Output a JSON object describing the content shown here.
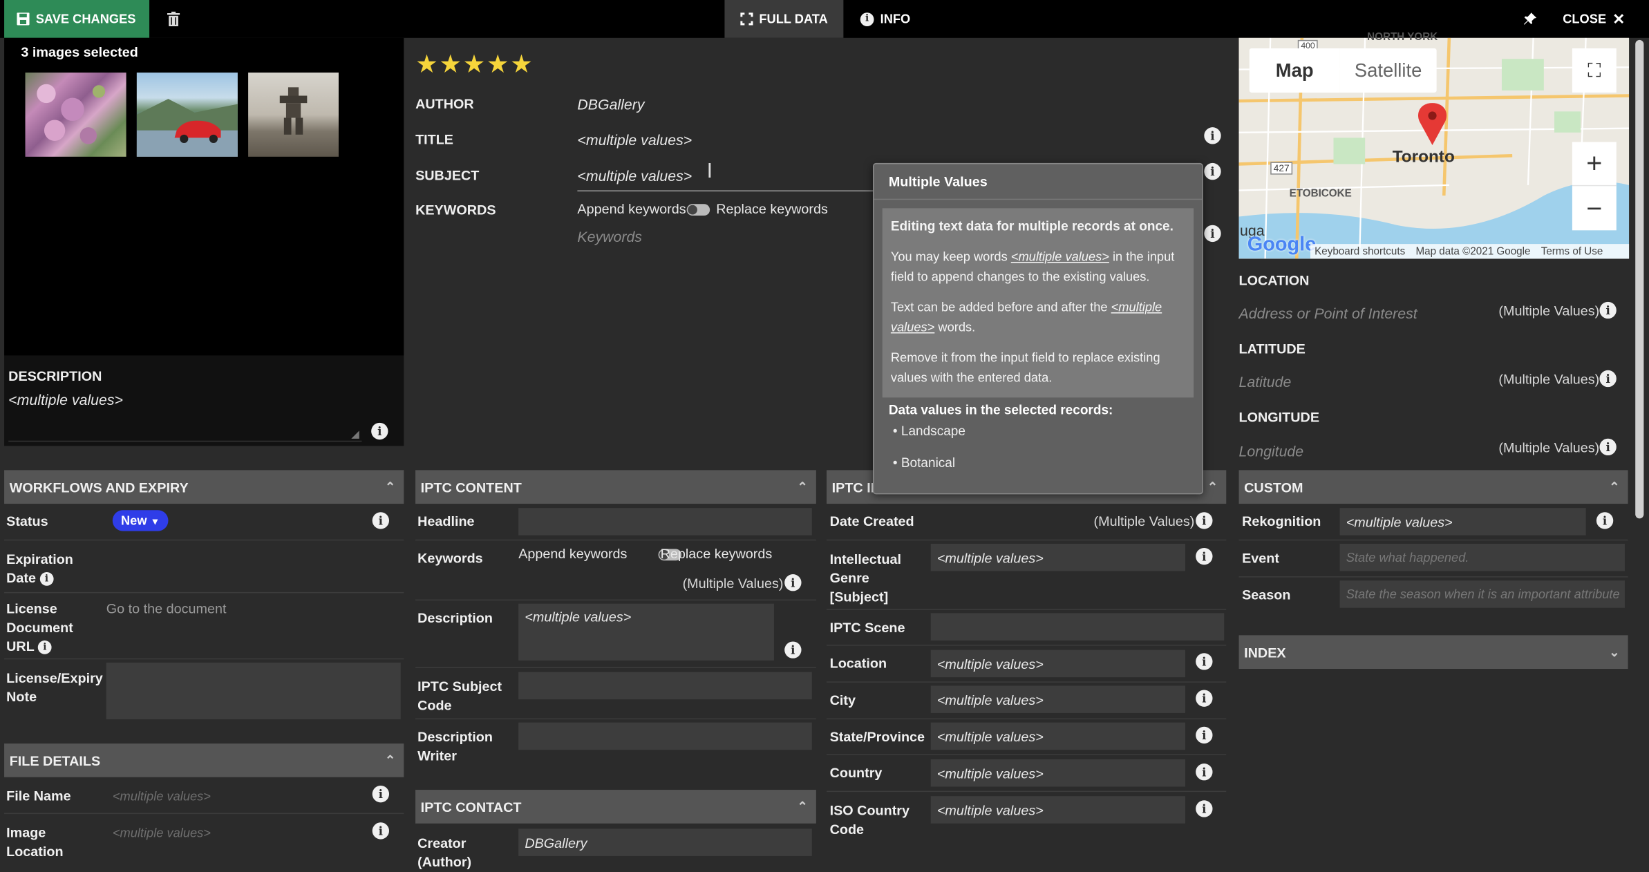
{
  "toolbar": {
    "save": "SAVE CHANGES",
    "full_data": "FULL DATA",
    "info": "INFO",
    "close": "CLOSE"
  },
  "selection": {
    "count_label": "3 images selected"
  },
  "rating": {
    "stars": 5
  },
  "description": {
    "label": "DESCRIPTION",
    "value": "<multiple values>"
  },
  "fields": {
    "author": {
      "label": "AUTHOR",
      "value": "DBGallery"
    },
    "title": {
      "label": "TITLE",
      "value": "<multiple values>"
    },
    "subject": {
      "label": "SUBJECT",
      "value": "<multiple values>"
    },
    "keywords": {
      "label": "KEYWORDS",
      "append": "Append keywords",
      "replace": "Replace keywords",
      "placeholder": "Keywords"
    }
  },
  "tooltip": {
    "title": "Multiple Values",
    "heading": "Editing text data for multiple records at once.",
    "p1a": "You may keep words ",
    "p1link": "<multiple values>",
    "p1b": " in the input field to append changes to the existing values.",
    "p2a": "Text can be added before and after the ",
    "p2link": "<multiple values>",
    "p2b": " words.",
    "p3": "Remove it from the input field to replace existing values with the entered data.",
    "values_heading": "Data values in the selected records:",
    "values": [
      "Landscape",
      "Botanical"
    ]
  },
  "map": {
    "map_tab": "Map",
    "satellite_tab": "Satellite",
    "city": "Toronto",
    "district": "ETOBICOKE",
    "top_label": "NORTH YORK",
    "road1": "400",
    "road2": "427",
    "logo": "Google",
    "prefix": "uga",
    "keyboard": "Keyboard shortcuts",
    "mapdata": "Map data ©2021 Google",
    "terms": "Terms of Use"
  },
  "location": {
    "label": "LOCATION",
    "placeholder": "Address or Point of Interest",
    "mv": "(Multiple Values)"
  },
  "latitude": {
    "label": "LATITUDE",
    "placeholder": "Latitude",
    "mv": "(Multiple Values)"
  },
  "longitude": {
    "label": "LONGITUDE",
    "placeholder": "Longitude",
    "mv": "(Multiple Values)"
  },
  "workflows": {
    "title": "WORKFLOWS AND EXPIRY",
    "status_label": "Status",
    "status_value": "New",
    "expiration": "Expiration Date",
    "license_url": "License Document URL",
    "license_url_value": "Go to the document",
    "license_note": "License/Expiry Note"
  },
  "file_details": {
    "title": "FILE DETAILS",
    "file_name": "File Name",
    "file_name_value": "<multiple values>",
    "image_location": "Image Location",
    "image_location_value": "<multiple values>"
  },
  "iptc_content": {
    "title": "IPTC CONTENT",
    "headline": "Headline",
    "keywords": "Keywords",
    "append": "Append keywords",
    "replace": "Replace keywords",
    "mv": "(Multiple Values)",
    "description": "Description",
    "description_value": "<multiple values>",
    "subject_code": "IPTC Subject Code",
    "desc_writer": "Description Writer"
  },
  "iptc_contact": {
    "title": "IPTC CONTACT",
    "creator": "Creator (Author)",
    "creator_value": "DBGallery"
  },
  "iptc_image": {
    "title": "IPTC II",
    "date_created": "Date Created",
    "date_mv": "(Multiple Values)",
    "genre": "Intellectual Genre [Subject]",
    "genre_value": "<multiple values>",
    "scene": "IPTC Scene",
    "location": "Location",
    "location_value": "<multiple values>",
    "city": "City",
    "city_value": "<multiple values>",
    "state": "State/Province",
    "state_value": "<multiple values>",
    "country": "Country",
    "country_value": "<multiple values>",
    "iso": "ISO Country Code",
    "iso_value": "<multiple values>"
  },
  "custom": {
    "title": "CUSTOM",
    "rekognition": "Rekognition",
    "rekognition_value": "<multiple values>",
    "event": "Event",
    "event_placeholder": "State what happened.",
    "season": "Season",
    "season_placeholder": "State the season when it is an important attribute"
  },
  "index": {
    "title": "INDEX"
  },
  "icons": {
    "info": "i",
    "chevron_up": "^",
    "chevron_down": "v"
  }
}
